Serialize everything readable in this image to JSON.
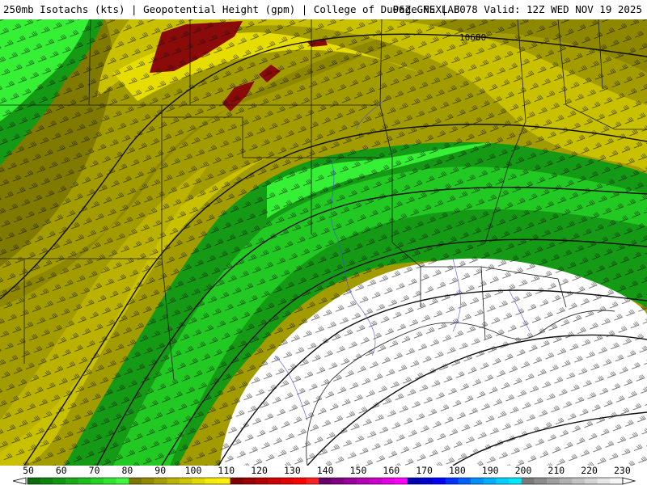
{
  "header": {
    "left": "250mb Isotachs (kts) | Geopotential Height (gpm) | College of DuPage NEXLAB",
    "right": "06Z GFS | F078 Valid: 12Z WED NOV 19 2025"
  },
  "map": {
    "contour_label": "10680",
    "colors": {
      "white": "#ffffff",
      "green_dark": "#159a15",
      "green": "#22c922",
      "green_light": "#35f035",
      "olive_dark": "#807a00",
      "olive": "#a39c00",
      "yellow_olive": "#c9c000",
      "yellow": "#ece200",
      "maroon": "#8b0a0a",
      "border": "#1a1a1a",
      "river": "#4040ff"
    }
  },
  "colorbar": {
    "labels": [
      "50",
      "60",
      "70",
      "80",
      "90",
      "100",
      "110",
      "120",
      "130",
      "140",
      "150",
      "160",
      "170",
      "180",
      "190",
      "200",
      "210",
      "220",
      "230"
    ],
    "swatches": [
      "#0a6e0a",
      "#0f820f",
      "#139613",
      "#18aa18",
      "#1cbe1c",
      "#22d222",
      "#2ee62e",
      "#40f840",
      "#7d7700",
      "#918a00",
      "#a69e00",
      "#bab100",
      "#cfc500",
      "#e3d800",
      "#f5eb00",
      "#fff000",
      "#800000",
      "#990000",
      "#b30000",
      "#cc0000",
      "#e60000",
      "#ff0000",
      "#ff2020",
      "#660066",
      "#800080",
      "#990099",
      "#b300b3",
      "#cc00cc",
      "#e600e6",
      "#ff00ff",
      "#0000b0",
      "#0000d0",
      "#0000ff",
      "#0030ff",
      "#0060ff",
      "#0090ff",
      "#00b0ff",
      "#00d0ff",
      "#00e8ff",
      "#7a7a7a",
      "#8c8c8c",
      "#9e9e9e",
      "#b0b0b0",
      "#c2c2c2",
      "#d4d4d4",
      "#e6e6e6",
      "#f5f5f5"
    ]
  }
}
